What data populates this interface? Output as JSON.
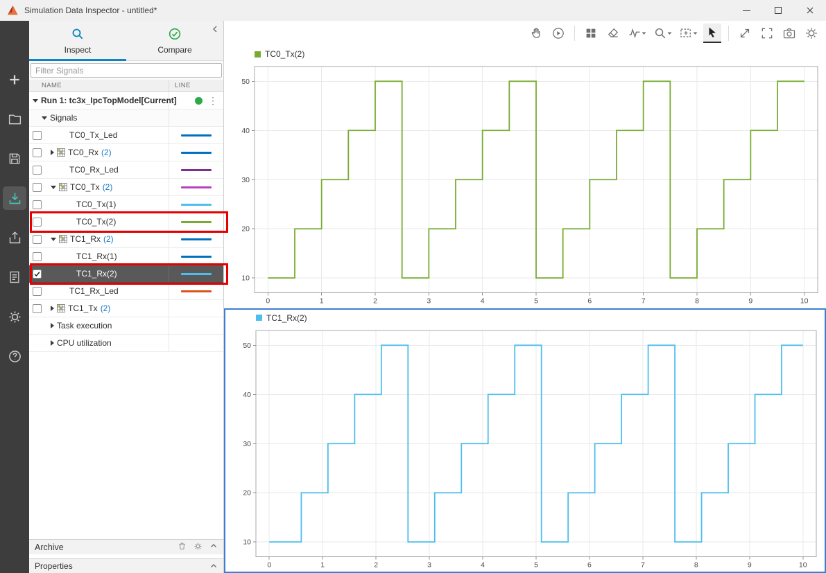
{
  "window": {
    "title": "Simulation Data Inspector - untitled*"
  },
  "colors": {
    "accent_blue": "#0d84c4",
    "link_blue": "#1779c4",
    "run_status_green": "#2ca949",
    "selection_border_blue": "#3c7fd0",
    "annotation_red": "#e60000",
    "active_tool_teal": "#45c4b2",
    "selected_row_gray": "#595959"
  },
  "left_toolbar": {
    "icons": [
      "add",
      "open",
      "save",
      "import",
      "export",
      "create-report",
      "preferences",
      "help"
    ],
    "active": "import"
  },
  "sidebar": {
    "tabs": [
      {
        "label": "Inspect",
        "active": true
      },
      {
        "label": "Compare",
        "active": false
      }
    ],
    "filter": {
      "placeholder": "Filter Signals"
    },
    "columns": [
      "NAME",
      "LINE"
    ],
    "rows": [
      {
        "kind": "run",
        "label": "Run 1: tc3x_IpcTopModel[Current]",
        "expanded": true
      },
      {
        "kind": "section",
        "label": "Signals",
        "expanded": true
      },
      {
        "kind": "signal",
        "label": "TC0_Tx_Led",
        "checked": false,
        "color": "#0072bd"
      },
      {
        "kind": "group",
        "label": "TC0_Rx",
        "count": "2",
        "expanded": false,
        "checked": false,
        "color": "#0072bd"
      },
      {
        "kind": "signal",
        "label": "TC0_Rx_Led",
        "checked": false,
        "color": "#7e2f8e"
      },
      {
        "kind": "group",
        "label": "TC0_Tx",
        "count": "2",
        "expanded": true,
        "checked": false,
        "color": "#b83fbf"
      },
      {
        "kind": "child",
        "label": "TC0_Tx(1)",
        "checked": false,
        "color": "#4dbeee"
      },
      {
        "kind": "child",
        "label": "TC0_Tx(2)",
        "checked": false,
        "color": "#77ac30",
        "highlighted": true
      },
      {
        "kind": "group",
        "label": "TC1_Rx",
        "count": "2",
        "expanded": true,
        "checked": false,
        "color": "#0072bd"
      },
      {
        "kind": "child",
        "label": "TC1_Rx(1)",
        "checked": false,
        "color": "#0072bd"
      },
      {
        "kind": "child",
        "label": "TC1_Rx(2)",
        "checked": true,
        "selected": true,
        "color": "#4dbeee",
        "highlighted": true
      },
      {
        "kind": "signal",
        "label": "TC1_Rx_Led",
        "checked": false,
        "color": "#d95319"
      },
      {
        "kind": "group",
        "label": "TC1_Tx",
        "count": "2",
        "expanded": false,
        "checked": false,
        "color": null
      },
      {
        "kind": "subsection",
        "label": "Task execution"
      },
      {
        "kind": "subsection",
        "label": "CPU utilization"
      }
    ],
    "archive": {
      "label": "Archive"
    },
    "properties": {
      "label": "Properties"
    }
  },
  "plot_toolbar": {
    "tools": [
      "pan",
      "replay",
      "layout",
      "data-brush",
      "signal-trace",
      "zoom",
      "zoom-region",
      "pointer",
      "expand",
      "fit-to-view",
      "snapshot",
      "preferences"
    ],
    "selected": "pointer"
  },
  "chart_data": [
    {
      "type": "line",
      "line_style": "staircase",
      "legend": "TC0_Tx(2)",
      "color": "#77ac30",
      "x": [
        0,
        0.5,
        1,
        1.5,
        2,
        2.5,
        3,
        3.5,
        4,
        4.5,
        5,
        5.5,
        6,
        6.5,
        7,
        7.5,
        8,
        8.5,
        9,
        9.5
      ],
      "y": [
        10,
        20,
        30,
        40,
        50,
        10,
        20,
        30,
        40,
        50,
        10,
        20,
        30,
        40,
        50,
        10,
        20,
        30,
        40,
        50
      ],
      "x_end": 10,
      "xlim": [
        -0.25,
        10.25
      ],
      "ylim": [
        7,
        53
      ],
      "x_ticks": [
        0,
        1,
        2,
        3,
        4,
        5,
        6,
        7,
        8,
        9,
        10
      ],
      "y_ticks": [
        10,
        20,
        30,
        40,
        50
      ],
      "grid": true,
      "selected": false
    },
    {
      "type": "line",
      "line_style": "staircase",
      "legend": "TC1_Rx(2)",
      "color": "#4dbeee",
      "x": [
        0,
        0.6,
        1.1,
        1.6,
        2.1,
        2.6,
        3.1,
        3.6,
        4.1,
        4.6,
        5.1,
        5.6,
        6.1,
        6.6,
        7.1,
        7.6,
        8.1,
        8.6,
        9.1,
        9.6
      ],
      "y": [
        10,
        20,
        30,
        40,
        50,
        10,
        20,
        30,
        40,
        50,
        10,
        20,
        30,
        40,
        50,
        10,
        20,
        30,
        40,
        50
      ],
      "x_end": 10,
      "xlim": [
        -0.25,
        10.25
      ],
      "ylim": [
        7,
        53
      ],
      "x_ticks": [
        0,
        1,
        2,
        3,
        4,
        5,
        6,
        7,
        8,
        9,
        10
      ],
      "y_ticks": [
        10,
        20,
        30,
        40,
        50
      ],
      "grid": true,
      "selected": true
    }
  ]
}
